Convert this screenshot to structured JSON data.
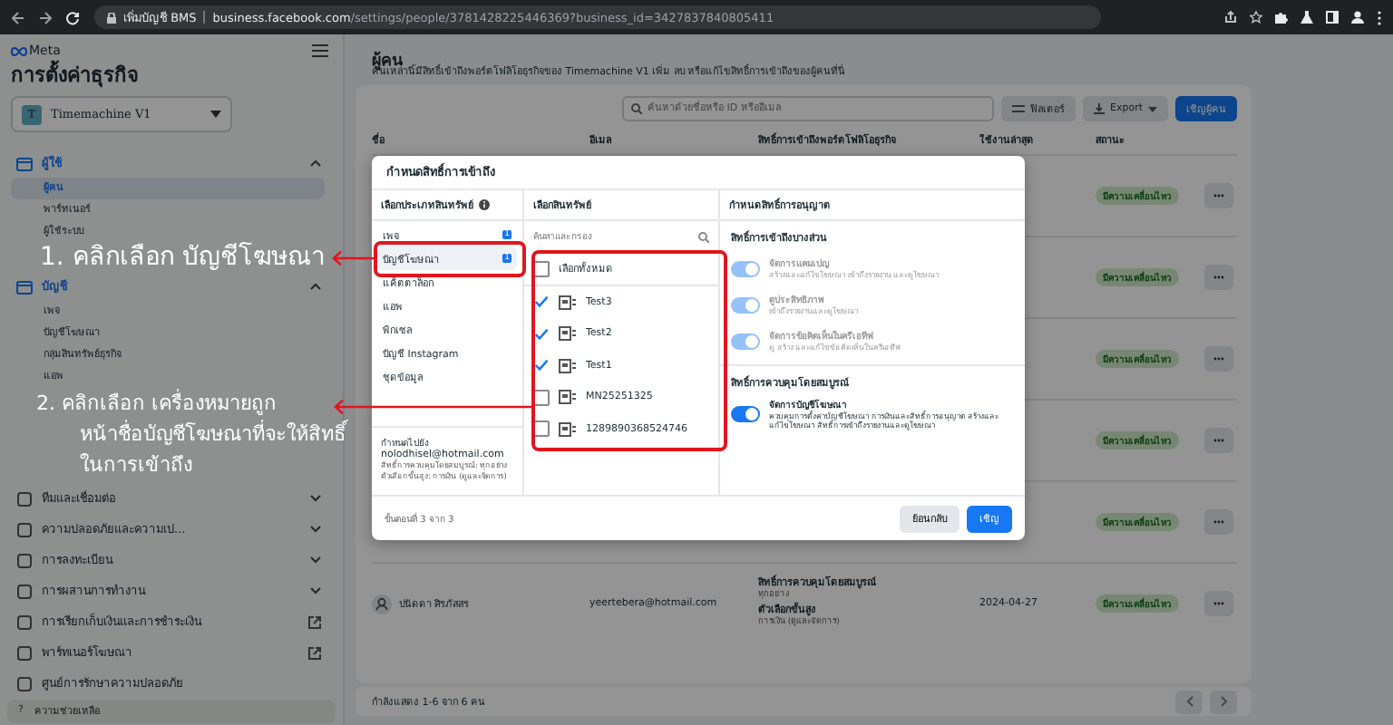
{
  "browser": {
    "site_label": "เพิ่มบัญชี BMS",
    "url_host": "business.facebook.com",
    "url_path": "/settings/people/3781428225446369?business_id=3427837840805411"
  },
  "sidebar": {
    "logo": "Meta",
    "title": "การตั้งค่าธุรกิจ",
    "account": {
      "initial": "T",
      "name": "Timemachine V1"
    },
    "sections": [
      {
        "label": "ผู้ใช้",
        "kind": "group",
        "expanded": true,
        "items": [
          {
            "label": "ผู้คน",
            "selected": true
          },
          {
            "label": "พาร์ทเนอร์",
            "selected": false
          },
          {
            "label": "ผู้ใช้ระบบ",
            "selected": false
          }
        ]
      },
      {
        "label": "บัญชี",
        "kind": "group",
        "expanded": true,
        "items": [
          {
            "label": "เพจ",
            "selected": false
          },
          {
            "label": "บัญชีโฆษณา",
            "selected": false
          },
          {
            "label": "กลุ่มสินทรัพย์ธุรกิจ",
            "selected": false
          },
          {
            "label": "แอพ",
            "selected": false
          }
        ]
      },
      {
        "label": "ทีมและเชื่อมต่อ",
        "kind": "group",
        "expanded": false
      },
      {
        "label": "ความปลอดภัยและความเป...",
        "kind": "group",
        "expanded": false
      },
      {
        "label": "การลงทะเบียน",
        "kind": "group",
        "expanded": false
      },
      {
        "label": "การผสานการทำงาน",
        "kind": "group",
        "expanded": false
      },
      {
        "label": "การเรียกเก็บเงินและการชำระเงิน",
        "kind": "external"
      },
      {
        "label": "พาร์ทเนอร์โฆษณา",
        "kind": "external"
      },
      {
        "label": "ศูนย์การรักษาความปลอดภัย",
        "kind": "plain"
      }
    ],
    "help_icon": "?",
    "help": "ความช่วยเหลือ"
  },
  "main": {
    "title": "ผู้คน",
    "subtitle": "คนเหล่านี้มีสิทธิ์เข้าถึงพอร์ตโฟลิโอธุรกิจของ Timemachine V1 เพิ่ม ลบ หรือแก้ไขสิทธิ์การเข้าถึงของผู้คนที่นี่",
    "search_placeholder": "ค้นหาด้วยชื่อหรือ ID หรืออีเมล",
    "filter_button": "ฟิลเตอร์",
    "export_button": "Export",
    "invite_button": "เชิญผู้คน",
    "columns": [
      "ชื่อ",
      "อีเมล",
      "สิทธิ์การเข้าถึงพอร์ตโฟลิโอธุรกิจ",
      "ใช้งานล่าสุด",
      "สถานะ"
    ],
    "rows": [
      {
        "status": "มีความเคลื่อนไหว"
      },
      {
        "status": "มีความเคลื่อนไหว"
      },
      {
        "status": "มีความเคลื่อนไหว"
      },
      {
        "status": "มีความเคลื่อนไหว"
      },
      {
        "status": "มีความเคลื่อนไหว"
      },
      {
        "name": "ปนัดดา ศิรภัสสร",
        "email": "yeertebera@hotmail.com",
        "access": [
          {
            "title": "สิทธิ์การควบคุมโดยสมบูรณ์",
            "detail": "ทุกอย่าง"
          },
          {
            "title": "ตัวเลือกขั้นสูง",
            "detail": "การเงิน (ดูและจัดการ)"
          }
        ],
        "last_active": "2024-04-27",
        "status": "มีความเคลื่อนไหว"
      }
    ],
    "footer": "กำลังแสดง 1-6 จาก 6 คน"
  },
  "modal": {
    "title": "กำหนดสิทธิ์การเข้าถึง",
    "asset_types": {
      "header": "เลือกประเภทสินทรัพย์",
      "items": [
        {
          "label": "เพจ",
          "selected": false,
          "badge": "1"
        },
        {
          "label": "บัญชีโฆษณา",
          "selected": true,
          "badge": "1"
        },
        {
          "label": "แค็ตตาล็อก",
          "selected": false
        },
        {
          "label": "แอพ",
          "selected": false
        },
        {
          "label": "พิกเซล",
          "selected": false
        },
        {
          "label": "บัญชี Instagram",
          "selected": false
        },
        {
          "label": "ชุดข้อมูล",
          "selected": false
        }
      ]
    },
    "assign_to": {
      "label": "กำหนดไปยัง",
      "email": "nolodhisel@hotmail.com",
      "summary": "สิทธิ์การควบคุมโดยสมบูรณ์: ทุกอย่าง ตัวเลือกขั้นสูง: การเงิน (ดูและจัดการ)"
    },
    "assets": {
      "header": "เลือกสินทรัพย์",
      "search_placeholder": "ค้นหาและกรอง",
      "select_all": {
        "label": "เลือกทั้งหมด",
        "checked": false
      },
      "items": [
        {
          "name": "Test3",
          "checked": true
        },
        {
          "name": "Test2",
          "checked": true
        },
        {
          "name": "Test1",
          "checked": true
        },
        {
          "name": "MN25251325",
          "checked": false
        },
        {
          "name": "1289890368524746",
          "checked": false
        }
      ]
    },
    "permissions": {
      "header": "กำหนดสิทธิ์การอนุญาต",
      "sections": [
        {
          "title": "สิทธิ์การเข้าถึงบางส่วน",
          "items": [
            {
              "title": "จัดการแคมเปญ",
              "description": "สร้างและแก้ไขโฆษณา เข้าถึงรายงาน และดูโฆษณา",
              "on": true,
              "disabled": true
            },
            {
              "title": "ดูประสิทธิภาพ",
              "description": "เข้าถึงรายงานและดูโฆษณา",
              "on": true,
              "disabled": true
            },
            {
              "title": "จัดการข้อคิดเห็นในครีเอทีฟ",
              "description": "ดู สร้าง และแก้ไขข้อคิดเห็นในครีเอทีฟ",
              "on": true,
              "disabled": true
            }
          ]
        },
        {
          "title": "สิทธิ์การควบคุมโดยสมบูรณ์",
          "items": [
            {
              "title": "จัดการบัญชีโฆษณา",
              "description": "ควบคุมการตั้งค่าบัญชีโฆษณา การเงินและสิทธิ์การอนุญาต สร้างและแก้ไขโฆษณา สิทธิ์การเข้าถึงรายงานและดูโฆษณา",
              "on": true,
              "disabled": false
            }
          ]
        }
      ]
    },
    "step": "ขั้นตอนที่ 3 จาก 3",
    "back_button": "ย้อนกลับ",
    "invite_button": "เชิญ"
  },
  "annotations": [
    "1. คลิกเลือก บัญชีโฆษณา",
    "2. คลิกเลือก เครื่องหมายถูก\nหน้าชื่อบัญชีโฆษณาที่จะให้สิทธิ์\nในการเข้าถึง"
  ]
}
